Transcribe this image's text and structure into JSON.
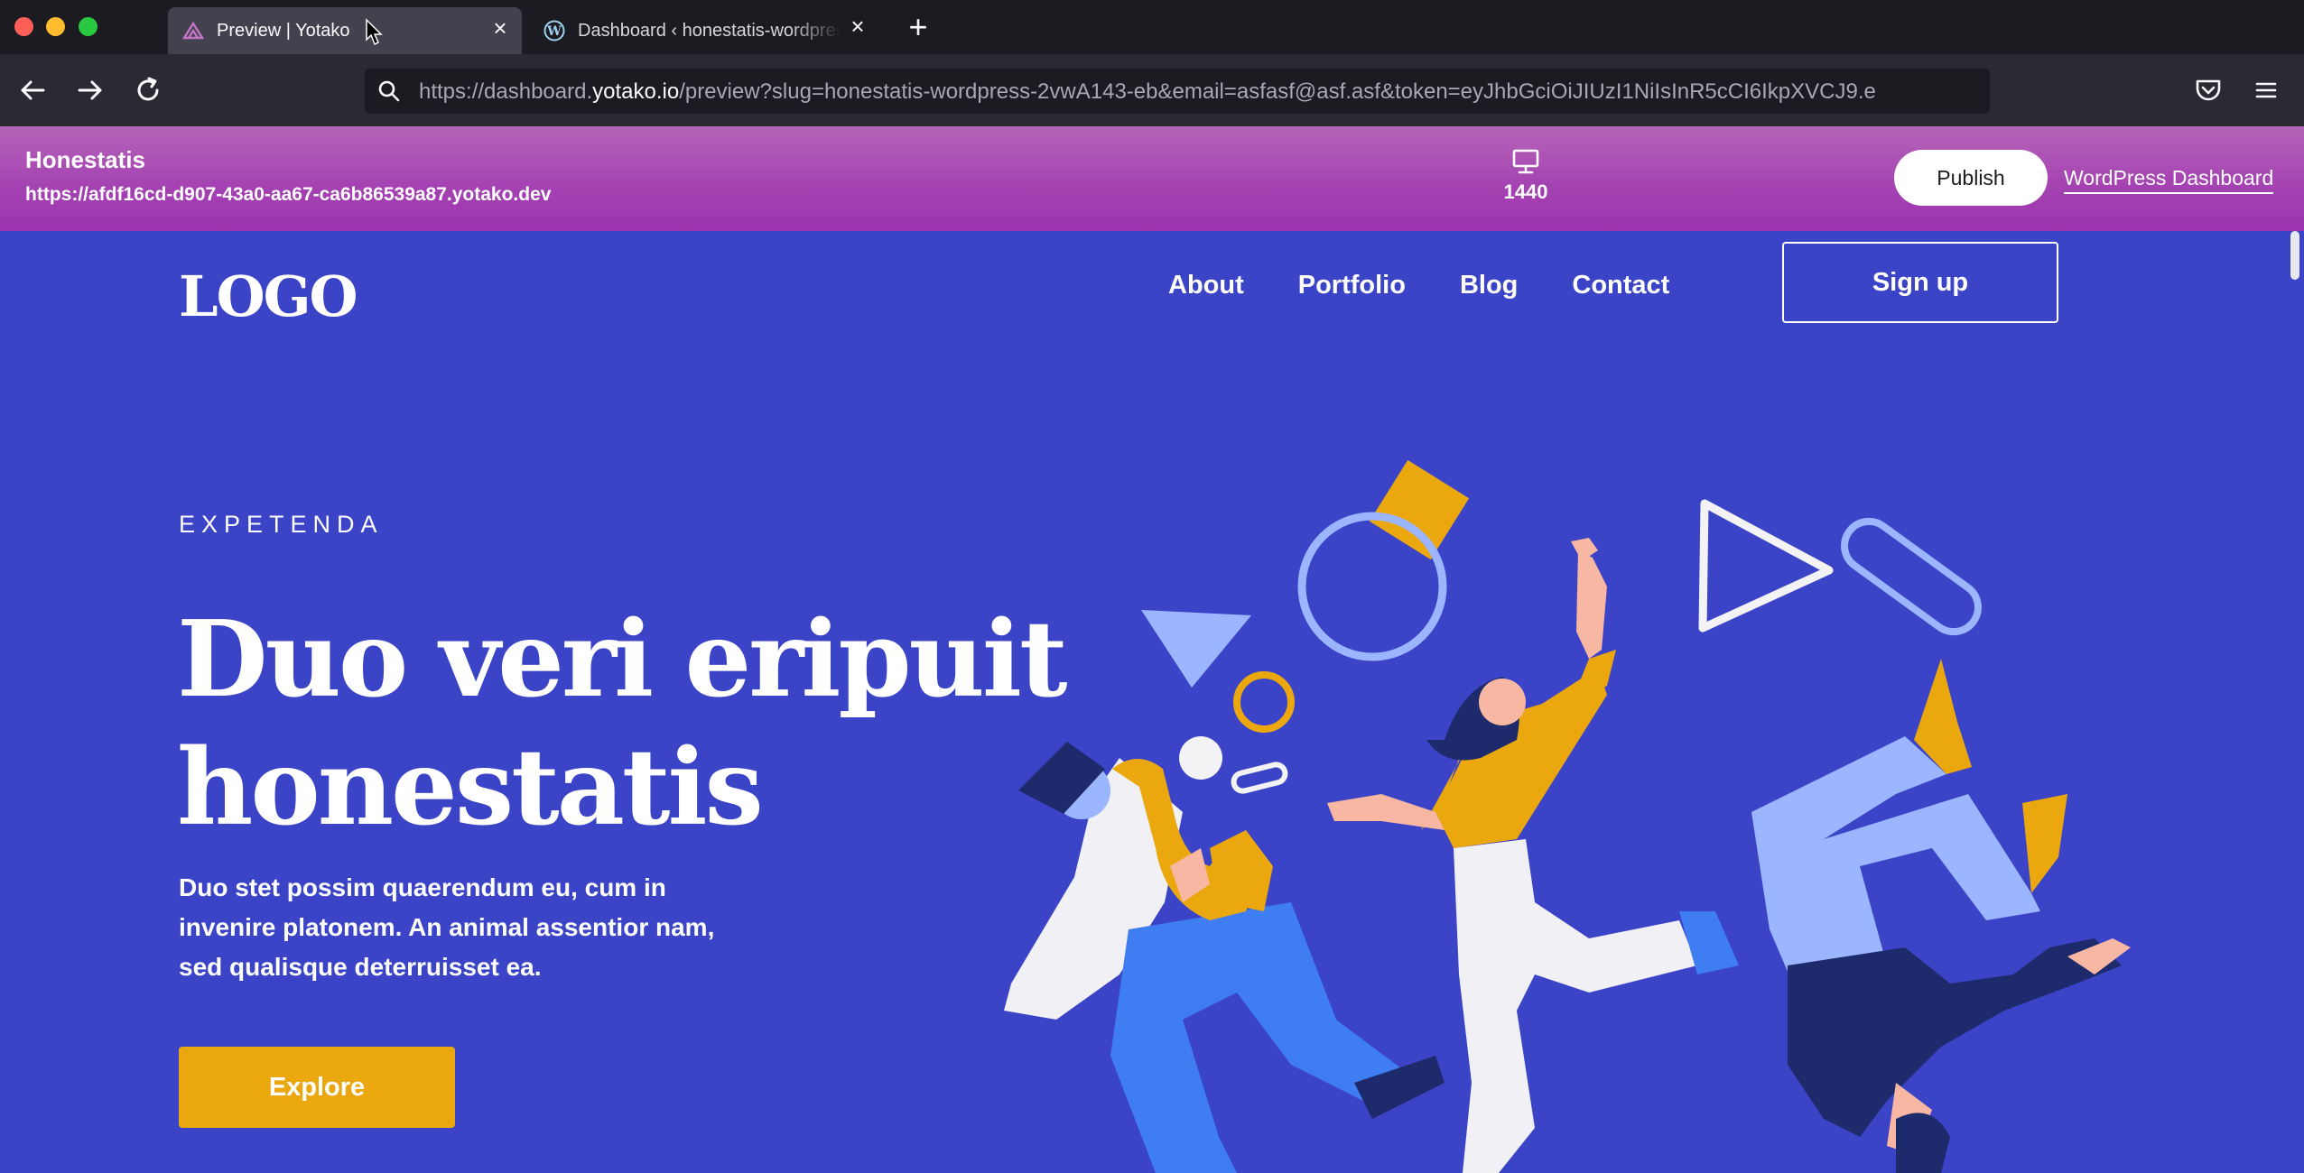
{
  "browser": {
    "tabs": [
      {
        "title": "Preview | Yotako",
        "active": true,
        "icon": "yotako-icon"
      },
      {
        "title": "Dashboard ‹ honestatis-wordpress",
        "active": false,
        "icon": "wordpress-icon"
      }
    ],
    "url": {
      "prefix": "https://dashboard.",
      "host": "yotako.io",
      "rest": "/preview?slug=honestatis-wordpress-2vwA143-eb&email=asfasf@asf.asf&token=eyJhbGciOiJIUzI1NiIsInR5cCI6IkpXVCJ9.e"
    }
  },
  "preview_bar": {
    "title": "Honestatis",
    "url": "https://afdf16cd-d907-43a0-aa67-ca6b86539a87.yotako.dev",
    "device_width": "1440",
    "publish_label": "Publish",
    "wp_dashboard_label": "WordPress Dashboard",
    "gradient": [
      "#b565b8",
      "#9b34ae"
    ]
  },
  "site": {
    "logo": "LOGO",
    "nav": [
      "About",
      "Portfolio",
      "Blog",
      "Contact"
    ],
    "signup_label": "Sign up",
    "eyebrow": "EXPETENDA",
    "hero_title_line1": "Duo veri eripuit",
    "hero_title_line2": "honestatis",
    "hero_body_line1": "Duo stet possim quaerendum eu, cum in",
    "hero_body_line2": "invenire platonem. An animal assentior nam,",
    "hero_body_line3": "sed qualisque deterruisset ea.",
    "explore_label": "Explore",
    "colors": {
      "background": "#3b43c7",
      "accent": "#eba80e",
      "text": "#ffffff"
    }
  }
}
